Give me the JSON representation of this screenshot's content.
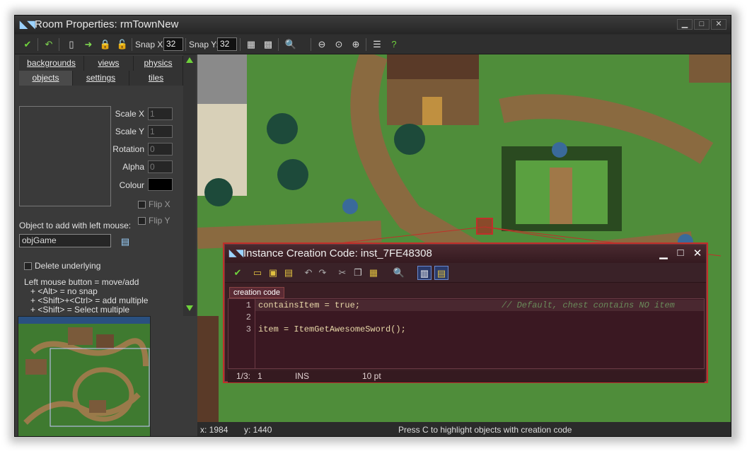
{
  "window": {
    "title": "Room Properties: rmTownNew",
    "min": "▁",
    "max": "□",
    "close": "✕"
  },
  "toolbar": {
    "snapx_label": "Snap X:",
    "snapx_value": "32",
    "snapy_label": "Snap Y:",
    "snapy_value": "32"
  },
  "tabs": {
    "backgrounds": "backgrounds",
    "views": "views",
    "physics": "physics",
    "objects": "objects",
    "settings": "settings",
    "tiles": "tiles"
  },
  "props": {
    "scalex_label": "Scale X",
    "scalex_value": "1",
    "scaley_label": "Scale Y",
    "scaley_value": "1",
    "rotation_label": "Rotation",
    "rotation_value": "0",
    "alpha_label": "Alpha",
    "alpha_value": "0",
    "colour_label": "Colour",
    "flipx_label": "Flip X",
    "flipy_label": "Flip Y"
  },
  "object": {
    "label": "Object to add with left mouse:",
    "value": "objGame"
  },
  "options": {
    "delete_underlying": "Delete underlying"
  },
  "help": [
    "Left mouse button = move/add",
    "+ <Alt> = no snap",
    "+ <Shift>+<Ctrl> = add multiple",
    "+ <Shift> = Select multiple"
  ],
  "status": {
    "x": "x: 1984",
    "y": "y: 1440",
    "hint": "Press C to highlight objects with creation code"
  },
  "dialog": {
    "title": "Instance Creation Code: inst_7FE48308",
    "tab": "creation code",
    "lines": [
      {
        "num": "1",
        "code": "containsItem = true;",
        "comment": "// Default, chest contains NO item"
      },
      {
        "num": "2",
        "code": "",
        "comment": ""
      },
      {
        "num": "3",
        "code": "item = ItemGetAwesomeSword();",
        "comment": ""
      }
    ],
    "status_pos": "1/3:",
    "status_col": "1",
    "status_mode": "INS",
    "status_font": "10 pt"
  },
  "colors": {
    "accent": "#9cd3ff",
    "confirm": "#6fd23c",
    "dialog_bg": "#3a1e24",
    "selection": "#c0302a"
  }
}
